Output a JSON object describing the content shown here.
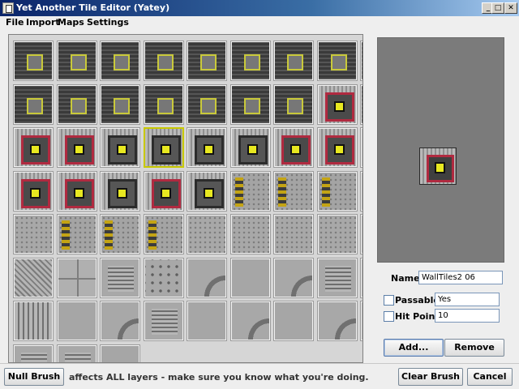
{
  "window": {
    "title": "Yet Another Tile Editor (Yatey)",
    "min_glyph": "_",
    "max_glyph": "□",
    "close_glyph": "✕"
  },
  "menu": {
    "file": "File",
    "import": "Import",
    "maps": "Maps",
    "settings": "Settings"
  },
  "tiles": {
    "rows": [
      [
        "dark",
        "dark",
        "dark",
        "dark",
        "dark",
        "dark",
        "dark",
        "dark",
        "dark"
      ],
      [
        "dark",
        "dark",
        "dark",
        "dark",
        "dark",
        "dark",
        "dark",
        "pad red",
        "dark"
      ],
      [
        "pad red",
        "pad red",
        "pad",
        "pad selected",
        "pad",
        "pad",
        "pad red",
        "pad red",
        "pad"
      ],
      [
        "pad red",
        "pad red",
        "pad",
        "pad red",
        "pad",
        "hazard",
        "hazard",
        "hazard",
        "hazard"
      ],
      [
        "floor",
        "hazard",
        "hazard",
        "hazard",
        "floor",
        "floor",
        "floor",
        "floor",
        "floor"
      ],
      [
        "diag",
        "grid",
        "bars",
        "rivets",
        "curve",
        "plain",
        "curve",
        "bars",
        "bars"
      ],
      [
        "vbars",
        "plain",
        "curve",
        "bars",
        "plain",
        "curve",
        "plain",
        "curve",
        "bars"
      ],
      [
        "bars",
        "bars",
        "plain"
      ]
    ]
  },
  "properties": {
    "name_label": "Name:",
    "name_value": "WallTiles2 06",
    "passable_label": "Passable:",
    "passable_value": "Yes",
    "hit_points_label": "Hit Points:",
    "hit_points_value": "10",
    "add_button": "Add...",
    "remove_button": "Remove"
  },
  "bottom": {
    "null_brush": "Null Brush",
    "message": "affects ALL layers - make sure you know what you're doing.",
    "clear_brush": "Clear Brush",
    "cancel": "Cancel"
  }
}
